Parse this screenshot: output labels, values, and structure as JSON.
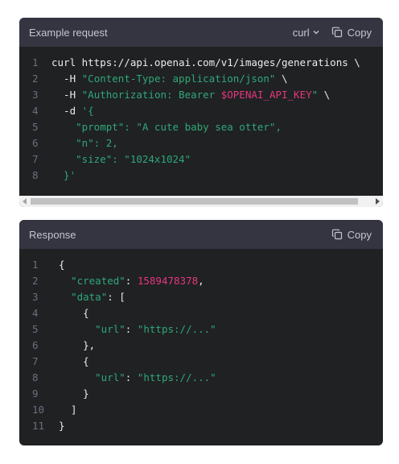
{
  "request": {
    "title": "Example request",
    "language": "curl",
    "copy_label": "Copy",
    "lines": [
      {
        "n": "1",
        "tokens": [
          {
            "t": "curl https://api.openai.com/v1/images/generations \\",
            "c": "plain"
          }
        ]
      },
      {
        "n": "2",
        "tokens": [
          {
            "t": "  -H ",
            "c": "plain"
          },
          {
            "t": "\"Content-Type: application/json\"",
            "c": "string"
          },
          {
            "t": " \\",
            "c": "plain"
          }
        ]
      },
      {
        "n": "3",
        "tokens": [
          {
            "t": "  -H ",
            "c": "plain"
          },
          {
            "t": "\"Authorization: Bearer ",
            "c": "string"
          },
          {
            "t": "$OPENAI_API_KEY",
            "c": "var"
          },
          {
            "t": "\"",
            "c": "string"
          },
          {
            "t": " \\",
            "c": "plain"
          }
        ]
      },
      {
        "n": "4",
        "tokens": [
          {
            "t": "  -d ",
            "c": "plain"
          },
          {
            "t": "'{",
            "c": "string"
          }
        ]
      },
      {
        "n": "5",
        "tokens": [
          {
            "t": "    \"prompt\": \"A cute baby sea otter\",",
            "c": "string"
          }
        ]
      },
      {
        "n": "6",
        "tokens": [
          {
            "t": "    \"n\": 2,",
            "c": "string"
          }
        ]
      },
      {
        "n": "7",
        "tokens": [
          {
            "t": "    \"size\": \"1024x1024\"",
            "c": "string"
          }
        ]
      },
      {
        "n": "8",
        "tokens": [
          {
            "t": "  }'",
            "c": "string"
          }
        ]
      }
    ]
  },
  "response": {
    "title": "Response",
    "copy_label": "Copy",
    "lines": [
      {
        "n": "1",
        "tokens": [
          {
            "t": "{",
            "c": "plain"
          }
        ]
      },
      {
        "n": "2",
        "tokens": [
          {
            "t": "  ",
            "c": "plain"
          },
          {
            "t": "\"created\"",
            "c": "string"
          },
          {
            "t": ": ",
            "c": "plain"
          },
          {
            "t": "1589478378",
            "c": "number"
          },
          {
            "t": ",",
            "c": "plain"
          }
        ]
      },
      {
        "n": "3",
        "tokens": [
          {
            "t": "  ",
            "c": "plain"
          },
          {
            "t": "\"data\"",
            "c": "string"
          },
          {
            "t": ": [",
            "c": "plain"
          }
        ]
      },
      {
        "n": "4",
        "tokens": [
          {
            "t": "    {",
            "c": "plain"
          }
        ]
      },
      {
        "n": "5",
        "tokens": [
          {
            "t": "      ",
            "c": "plain"
          },
          {
            "t": "\"url\"",
            "c": "string"
          },
          {
            "t": ": ",
            "c": "plain"
          },
          {
            "t": "\"https://...\"",
            "c": "string"
          }
        ]
      },
      {
        "n": "6",
        "tokens": [
          {
            "t": "    },",
            "c": "plain"
          }
        ]
      },
      {
        "n": "7",
        "tokens": [
          {
            "t": "    {",
            "c": "plain"
          }
        ]
      },
      {
        "n": "8",
        "tokens": [
          {
            "t": "      ",
            "c": "plain"
          },
          {
            "t": "\"url\"",
            "c": "string"
          },
          {
            "t": ": ",
            "c": "plain"
          },
          {
            "t": "\"https://...\"",
            "c": "string"
          }
        ]
      },
      {
        "n": "9",
        "tokens": [
          {
            "t": "    }",
            "c": "plain"
          }
        ]
      },
      {
        "n": "10",
        "tokens": [
          {
            "t": "  ]",
            "c": "plain"
          }
        ]
      },
      {
        "n": "11",
        "tokens": [
          {
            "t": "}",
            "c": "plain"
          }
        ]
      }
    ]
  },
  "icons": {
    "copy": "copy-icon",
    "chevron": "chevron-down-icon",
    "scroll_left": "arrow-left-icon",
    "scroll_right": "arrow-right-icon"
  },
  "colors": {
    "panel_bg": "#202123",
    "header_bg": "#343541",
    "string": "#2ea879",
    "number_var": "#e5377e",
    "line_number": "#6e6e80"
  }
}
